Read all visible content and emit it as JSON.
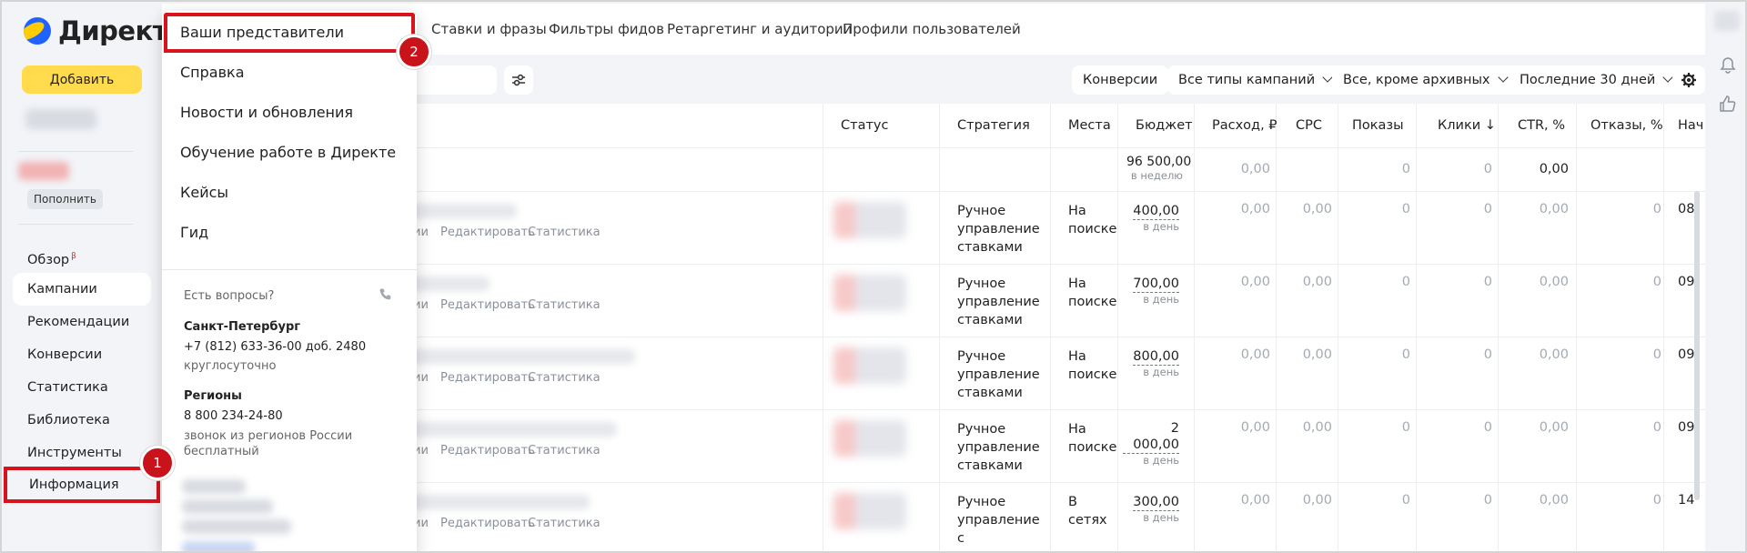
{
  "app": {
    "logo_text": "Директ",
    "add_button": "Добавить",
    "topup_button": "Пополнить"
  },
  "sidebar": {
    "items": [
      {
        "label": "Обзор",
        "badge": "β"
      },
      {
        "label": "Кампании"
      },
      {
        "label": "Рекомендации"
      },
      {
        "label": "Конверсии"
      },
      {
        "label": "Статистика"
      },
      {
        "label": "Библиотека"
      },
      {
        "label": "Инструменты"
      },
      {
        "label": "Информация"
      }
    ],
    "active": "Кампании"
  },
  "topnav": {
    "tabs": [
      "Ставки и фразы",
      "Фильтры фидов",
      "Ретаргетинг и аудитории",
      "Профили пользователей"
    ]
  },
  "filters": {
    "conversions": "Конверсии",
    "campaign_types": "Все типы кампаний",
    "archive": "Все, кроме архивных",
    "period": "Последние 30 дней"
  },
  "table": {
    "headers": [
      "Статус",
      "Стратегия",
      "Места п",
      "Бюджет, ₽",
      "Расход, ₽",
      "CPC",
      "Показы",
      "Клики ↓",
      "CTR, %",
      "Отказы, %",
      "Нач"
    ],
    "total_row": {
      "budget": "96 500,00",
      "budget_period": "в неделю",
      "spend": "0,00",
      "shows": "0",
      "clicks": "0",
      "ctr": "0,00"
    },
    "row_links": [
      "ии",
      "Редактировать",
      "Статистика"
    ],
    "rows": [
      {
        "strategy": [
          "Ручное",
          "управление",
          "ставками"
        ],
        "place": [
          "На",
          "поиске"
        ],
        "budget": "400,00",
        "budget_period": "в день",
        "spend": "0,00",
        "cpc": "0,00",
        "shows": "0",
        "clicks": "0",
        "ctr": "0,00",
        "bounce": "0",
        "start": "08"
      },
      {
        "strategy": [
          "Ручное",
          "управление",
          "ставками"
        ],
        "place": [
          "На",
          "поиске"
        ],
        "budget": "700,00",
        "budget_period": "в день",
        "spend": "0,00",
        "cpc": "0,00",
        "shows": "0",
        "clicks": "0",
        "ctr": "0,00",
        "bounce": "0",
        "start": "09"
      },
      {
        "strategy": [
          "Ручное",
          "управление",
          "ставками"
        ],
        "place": [
          "На",
          "поиске"
        ],
        "budget": "800,00",
        "budget_period": "в день",
        "spend": "0,00",
        "cpc": "0,00",
        "shows": "0",
        "clicks": "0",
        "ctr": "0,00",
        "bounce": "0",
        "start": "09"
      },
      {
        "strategy": [
          "Ручное",
          "управление",
          "ставками"
        ],
        "place": [
          "На",
          "поиске"
        ],
        "budget": "2 000,00",
        "budget_period": "в день",
        "spend": "0,00",
        "cpc": "0,00",
        "shows": "0",
        "clicks": "0",
        "ctr": "0,00",
        "bounce": "0",
        "start": "09"
      },
      {
        "strategy": [
          "Ручное",
          "управление",
          "с"
        ],
        "place": [
          "В",
          "сетях"
        ],
        "budget": "300,00",
        "budget_period": "в день",
        "spend": "0,00",
        "cpc": "0,00",
        "shows": "0",
        "clicks": "0",
        "ctr": "0,00",
        "bounce": "0",
        "start": "14"
      }
    ]
  },
  "menu": {
    "items": [
      "Ваши представители",
      "Справка",
      "Новости и обновления",
      "Обучение работе в Директе",
      "Кейсы",
      "Гид"
    ],
    "questions": "Есть вопросы?",
    "spb_title": "Санкт-Петербург",
    "spb_phone": "+7 (812) 633-36-00 доб. 2480",
    "spb_hours": "круглосуточно",
    "regions_title": "Регионы",
    "regions_phone": "8 800 234-24-80",
    "regions_note1": "звонок из регионов России",
    "regions_note2": "бесплатный"
  },
  "markers": {
    "one": "1",
    "two": "2"
  },
  "colors": {
    "accent_yellow": "#ffdb4d",
    "highlight_red": "#d6141d",
    "brand_blue": "#1f63ff"
  }
}
